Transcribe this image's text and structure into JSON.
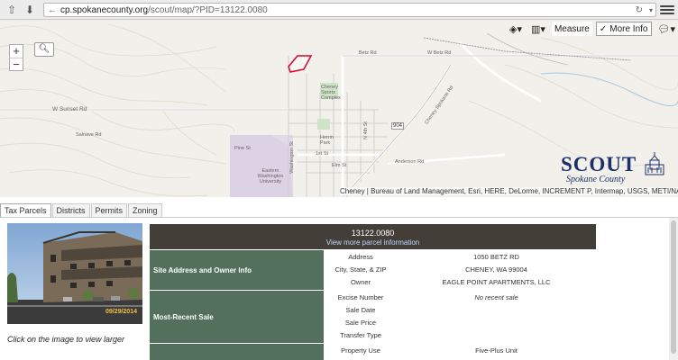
{
  "browser": {
    "url_host": "cp.spokanecounty.org",
    "url_path": "/scout/map/?PID=13122.0080"
  },
  "map": {
    "toolbar": {
      "measure_label": "Measure",
      "more_info_label": "More Info",
      "more_info_checked": "✓"
    },
    "zoom": {
      "in": "+",
      "out": "−"
    },
    "labels": {
      "betz_rd": "Betz Rd",
      "w_betz_rd": "W Betz Rd",
      "w_sunset_rd": "W Sunset Rd",
      "salnave_rd": "Salnave Rd",
      "cheney_sports_complex": "Cheney Sports Complex",
      "anderson_rd": "Anderson Rd",
      "cheney_spokane_rd": "Cheney Spokane Rd",
      "mile_904": "904",
      "w_1st_st": "1st St",
      "w_elm_st": "Elm St",
      "ewu": "Eastern Washington University",
      "herrin_park": "Herrin Park",
      "pine_st": "Pine St",
      "washington_st": "Washington St",
      "n_4th_st": "N 4th St"
    },
    "attribution": "Cheney | Bureau of Land Management, Esri, HERE, DeLorme, INCREMENT P, Intermap, USGS, METI/NASA, EPA, USDA",
    "logo": {
      "title": "SCOUT",
      "subtitle": "Spokane County"
    }
  },
  "tabs": [
    "Tax Parcels",
    "Districts",
    "Permits",
    "Zoning"
  ],
  "active_tab": "Tax Parcels",
  "parcel": {
    "pid": "13122.0080",
    "more_link": "View more parcel information",
    "photo_date": "09/29/2014",
    "photo_caption": "Click on the image to view larger",
    "sections": [
      {
        "label": "Site Address and Owner Info",
        "rows": [
          {
            "k": "Address",
            "v": "1050 BETZ RD"
          },
          {
            "k": "City, State, & ZIP",
            "v": "CHENEY, WA 99004"
          },
          {
            "k": "Owner",
            "v": "EAGLE POINT APARTMENTS, LLC"
          }
        ]
      },
      {
        "label": "Most-Recent Sale",
        "rows": [
          {
            "k": "Excise Number",
            "v": "No recent sale"
          },
          {
            "k": "Sale Date",
            "v": ""
          },
          {
            "k": "Sale Price",
            "v": ""
          },
          {
            "k": "Transfer Type",
            "v": ""
          }
        ]
      },
      {
        "label": "",
        "rows": [
          {
            "k": "Property Use",
            "v": "Five-Plus Unit"
          }
        ]
      }
    ]
  }
}
